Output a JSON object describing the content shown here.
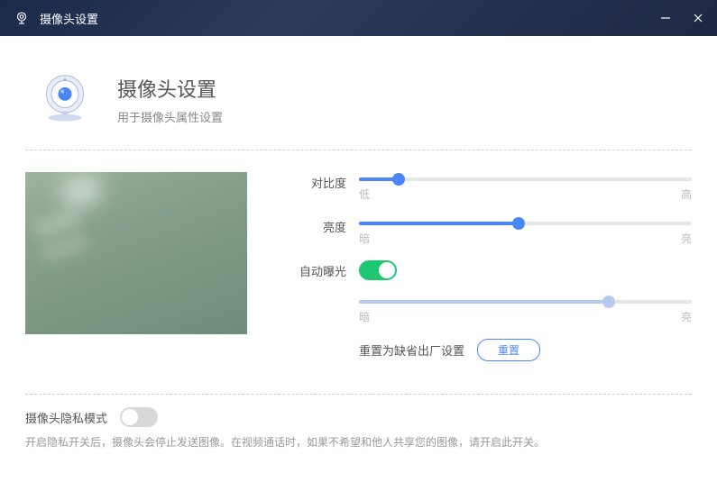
{
  "titlebar": {
    "title": "摄像头设置"
  },
  "header": {
    "title": "摄像头设置",
    "subtitle": "用于摄像头属性设置"
  },
  "sliders": {
    "contrast": {
      "label": "对比度",
      "low": "低",
      "high": "高",
      "value": 12
    },
    "brightness": {
      "label": "亮度",
      "low": "暗",
      "high": "亮",
      "value": 48
    },
    "exposure": {
      "label": "自动曝光",
      "low": "暗",
      "high": "亮",
      "value": 75,
      "auto": true
    }
  },
  "reset": {
    "label": "重置为缺省出厂设置",
    "button": "重置"
  },
  "privacy": {
    "title": "摄像头隐私模式",
    "enabled": false,
    "description": "开启隐私开关后，摄像头会停止发送图像。在视频通话时，如果不希望和他人共享您的图像，请开启此开关。"
  },
  "colors": {
    "accent": "#4a86f7",
    "toggle_on": "#1fc770"
  }
}
